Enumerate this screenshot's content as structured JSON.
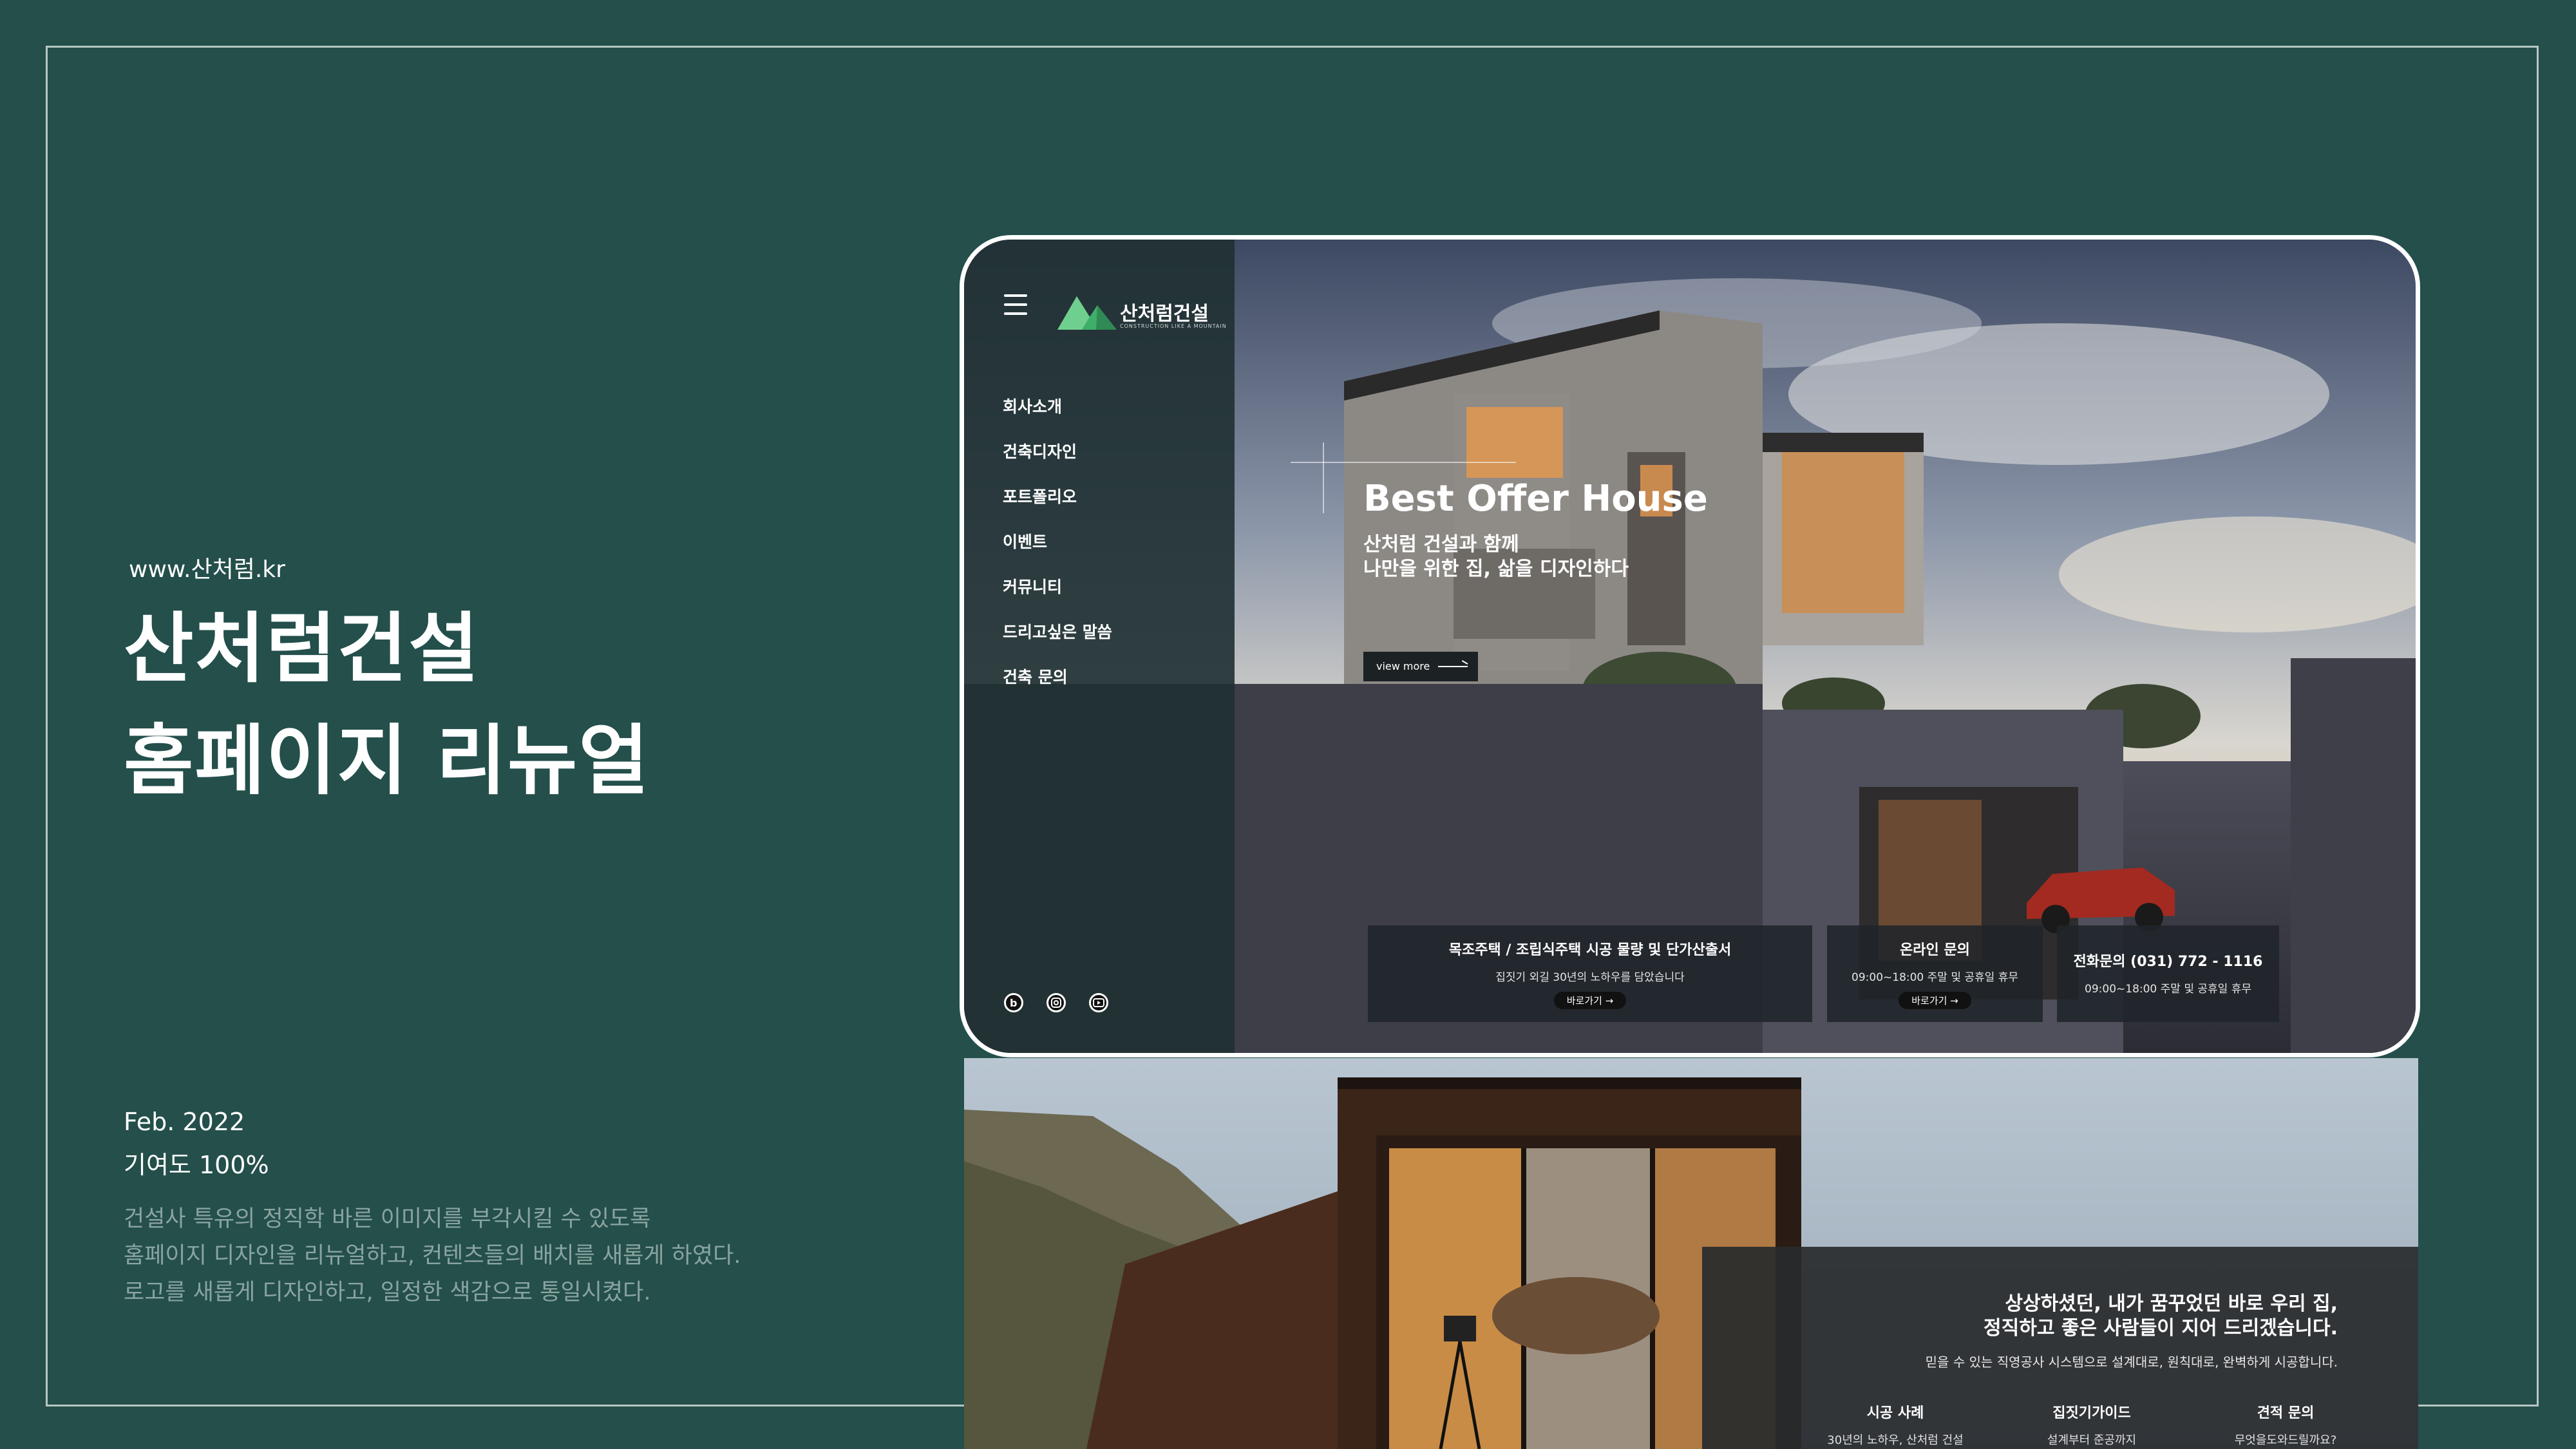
{
  "project": {
    "url": "www.산처럼.kr",
    "title_line1": "산처럼건설",
    "title_line2": "홈페이지 리뉴얼",
    "date": "Feb. 2022",
    "contribution": "기여도 100%",
    "description": [
      "건설사 특유의 정직학 바른 이미지를 부각시킬 수 있도록",
      "홈페이지 디자인을 리뉴얼하고, 컨텐츠들의 배치를 새롭게 하였다.",
      "로고를 새롭게 디자인하고, 일정한 색감으로 통일시켰다."
    ]
  },
  "mock_header": {
    "logo_text": "산처럼건설",
    "logo_sub": "CONSTRUCTION LIKE A MOUNTAIN"
  },
  "nav": {
    "items": [
      "회사소개",
      "건축디자인",
      "포트폴리오",
      "이벤트",
      "커뮤니티",
      "드리고싶은 말씀",
      "건축 문의"
    ]
  },
  "social": [
    "blog-icon",
    "instagram-icon",
    "youtube-icon"
  ],
  "hero": {
    "title": "Best Offer House",
    "subtitle_line1": "산처럼 건설과 함께",
    "subtitle_line2": "나만을 위한 집, 삶을 디자인하다",
    "button": "view more"
  },
  "info_cards": [
    {
      "title": "목조주택 / 조립식주택 시공 물량 및 단가산출서",
      "sub": "집짓기 외길 30년의 노하우를 담았습니다",
      "link": "바로가기 →"
    },
    {
      "title": "온라인 문의",
      "sub": "09:00~18:00 주말 및 공휴일 휴무",
      "link": "바로가기 →"
    },
    {
      "title": "전화문의 (031) 772 - 1116",
      "sub": "09:00~18:00 주말 및 공휴일 휴무"
    }
  ],
  "section2": {
    "head_line1": "상상하셨던, 내가 꿈꾸었던 바로 우리 집,",
    "head_line2": "정직하고 좋은 사람들이 지어 드리겠습니다.",
    "desc": "믿을 수 있는 직영공사 시스템으로 설계대로, 원칙대로, 완벽하게 시공합니다.",
    "links": [
      {
        "title": "시공 사례",
        "sub": "30년의 노하우, 산처럼 건설"
      },
      {
        "title": "집짓기가이드",
        "sub": "설계부터 준공까지"
      },
      {
        "title": "견적 문의",
        "sub": "무엇을도와드릴까요?"
      }
    ]
  },
  "colors": {
    "background": "#244f4b",
    "sidebar": "#1f3032",
    "accent_green": "#3fae6a"
  }
}
